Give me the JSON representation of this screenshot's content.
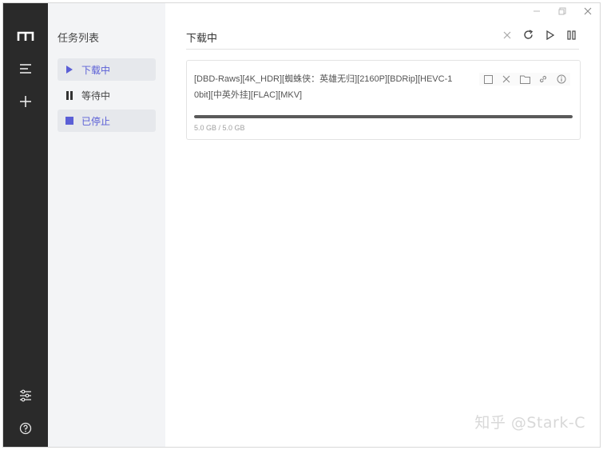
{
  "rail": {
    "logo_icon": "logo-m-icon",
    "items": [
      {
        "name": "task-list-icon"
      },
      {
        "name": "add-task-icon"
      }
    ],
    "bottom": [
      {
        "name": "settings-sliders-icon"
      },
      {
        "name": "help-icon"
      }
    ]
  },
  "task_panel": {
    "title": "任务列表",
    "items": [
      {
        "label": "下载中",
        "icon": "play-icon",
        "active": true
      },
      {
        "label": "等待中",
        "icon": "pause-icon",
        "active": false
      },
      {
        "label": "已停止",
        "icon": "stop-icon",
        "active": true
      }
    ]
  },
  "main": {
    "title": "下载中",
    "toolbar": [
      "close-icon",
      "refresh-icon",
      "play-icon",
      "pause-icon"
    ],
    "window_controls": [
      "minimize-icon",
      "maximize-icon",
      "close-icon"
    ]
  },
  "task": {
    "name": "[DBD-Raws][4K_HDR][蜘蛛侠：英雄无归][2160P][BDRip][HEVC-10bit][中英外挂][FLAC][MKV]",
    "progress": 1.0,
    "size": "5.0 GB / 5.0 GB",
    "actions": [
      "checkbox-icon",
      "delete-icon",
      "folder-icon",
      "link-icon",
      "info-icon"
    ]
  },
  "colors": {
    "rail_bg": "#2a2a2a",
    "panel_bg": "#f3f4f6",
    "accent": "#5b5fd6",
    "progress": "#5a5a5a"
  },
  "watermark": "知乎 @Stark-C"
}
